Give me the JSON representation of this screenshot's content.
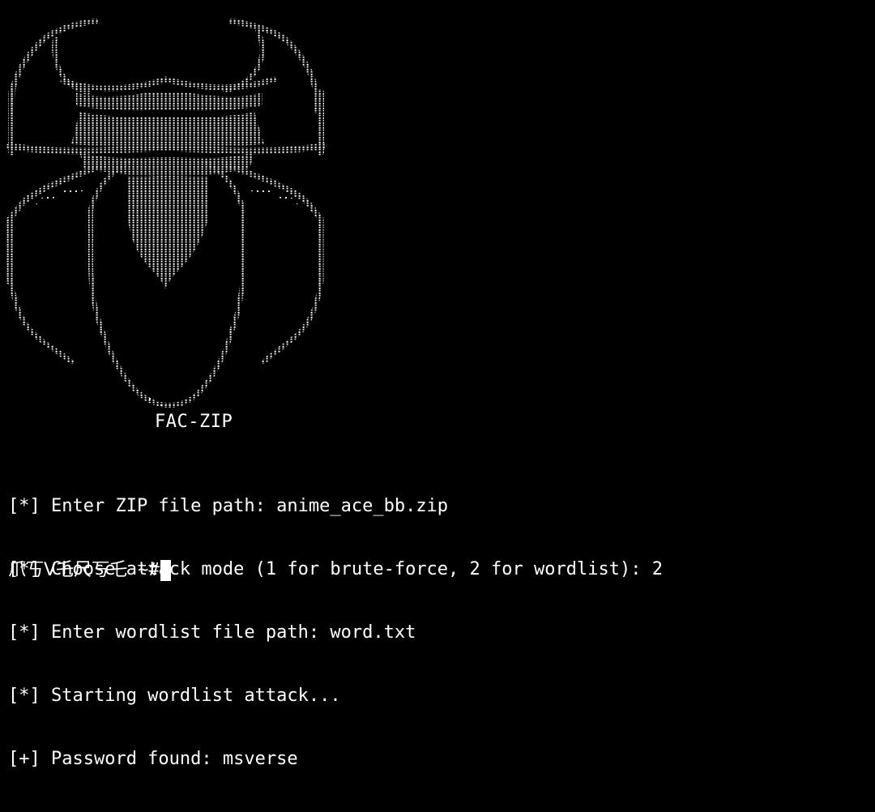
{
  "banner": {
    "title": "FAC-ZIP",
    "art_icon": "spider-ascii-art"
  },
  "output_lines": [
    "[*] Enter ZIP file path: anime_ace_bb.zip",
    "[*] Choose attack mode (1 for brute-force, 2 for wordlist): 2",
    "[*] Enter wordlist file path: word.txt",
    "[*] Starting wordlist attack...",
    "[+] Password found: msverse"
  ],
  "prompt": {
    "host": "爪丂V乇尺丂乇",
    "symbol": " ~#"
  },
  "colors": {
    "background": "#000000",
    "text": "#ffffff"
  }
}
